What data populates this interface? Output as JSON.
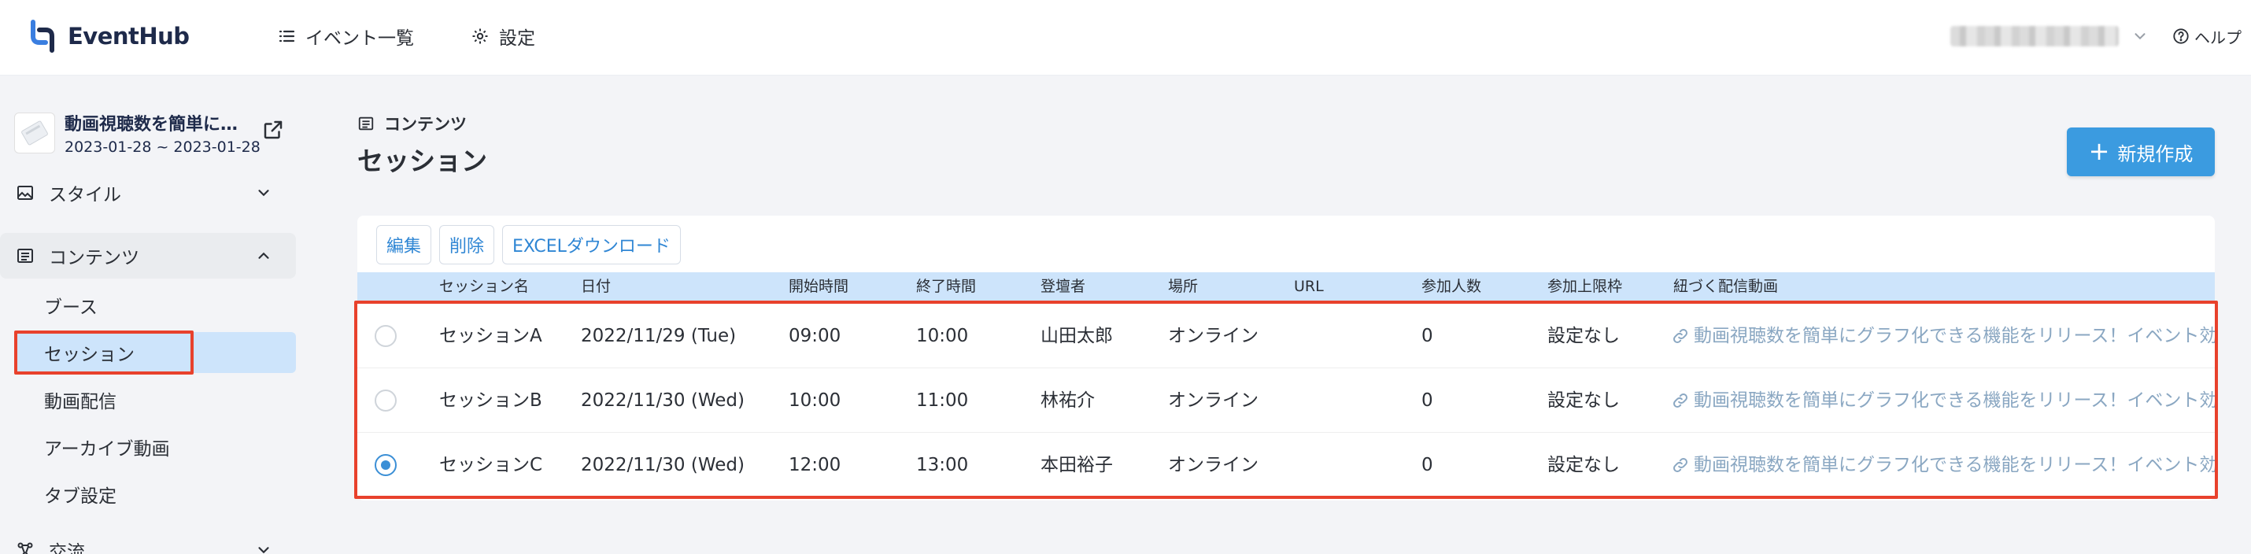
{
  "app": {
    "name": "EventHub"
  },
  "header": {
    "nav": [
      {
        "label": "イベント一覧",
        "icon": "list-icon"
      },
      {
        "label": "設定",
        "icon": "gear-icon"
      }
    ],
    "help_label": "ヘルプ"
  },
  "sidebar": {
    "event": {
      "title": "動画視聴数を簡単にグラフ化できる機能をリリース！イベント効果",
      "dates": "2023-01-28 ~ 2023-01-28"
    },
    "groups": [
      {
        "label": "スタイル",
        "icon": "image-icon",
        "expanded": false
      },
      {
        "label": "コンテンツ",
        "icon": "list-icon",
        "expanded": true
      },
      {
        "label": "交流",
        "icon": "network-icon",
        "expanded": false
      }
    ],
    "content_items": [
      {
        "label": "ブース",
        "active": false
      },
      {
        "label": "セッション",
        "active": true
      },
      {
        "label": "動画配信",
        "active": false
      },
      {
        "label": "アーカイブ動画",
        "active": false
      },
      {
        "label": "タブ設定",
        "active": false
      }
    ]
  },
  "main": {
    "breadcrumb": "コンテンツ",
    "title": "セッション",
    "new_button_label": "新規作成",
    "toolbar": {
      "edit": "編集",
      "delete": "削除",
      "excel": "EXCELダウンロード"
    },
    "columns": [
      "セッション名",
      "日付",
      "開始時間",
      "終了時間",
      "登壇者",
      "場所",
      "URL",
      "参加人数",
      "参加上限枠",
      "紐づく配信動画"
    ],
    "rows": [
      {
        "selected": false,
        "name": "セッションA",
        "date": "2022/11/29 (Tue)",
        "start": "09:00",
        "end": "10:00",
        "speaker": "山田太郎",
        "place": "オンライン",
        "url": "",
        "participants": "0",
        "limit": "設定なし",
        "video": "動画視聴数を簡単にグラフ化できる機能をリリース！イベント効果"
      },
      {
        "selected": false,
        "name": "セッションB",
        "date": "2022/11/30 (Wed)",
        "start": "10:00",
        "end": "11:00",
        "speaker": "林祐介",
        "place": "オンライン",
        "url": "",
        "participants": "0",
        "limit": "設定なし",
        "video": "動画視聴数を簡単にグラフ化できる機能をリリース！イベント効果"
      },
      {
        "selected": true,
        "name": "セッションC",
        "date": "2022/11/30 (Wed)",
        "start": "12:00",
        "end": "13:00",
        "speaker": "本田裕子",
        "place": "オンライン",
        "url": "",
        "participants": "0",
        "limit": "設定なし",
        "video": "動画視聴数を簡単にグラフ化できる機能をリリース！イベント効果"
      }
    ]
  },
  "colors": {
    "accent": "#3b9be0",
    "highlight": "#cde4fb",
    "annotation": "#e8412c",
    "link": "#8aa7c2"
  }
}
